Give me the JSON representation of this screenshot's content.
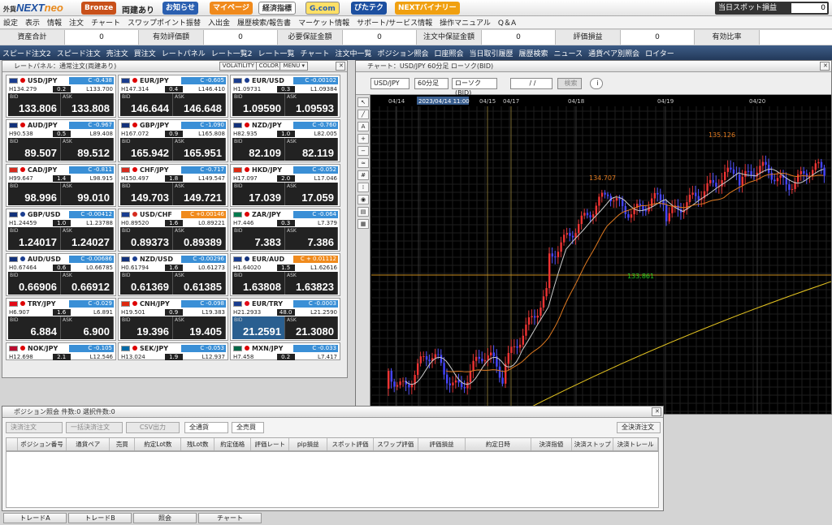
{
  "header": {
    "logo_prefix": "外貨",
    "logo_main": "NEXT",
    "logo_suffix": "neo",
    "rank_badge": "Bronze",
    "two_way": "両建あり",
    "buttons": [
      "お知らせ",
      "マイページ",
      "経済指標",
      "G.com",
      "ぴたテク",
      "NEXTバイナリー"
    ],
    "daily_pnl_label": "当日スポット損益",
    "daily_pnl_value": "0"
  },
  "menu": [
    "設定",
    "表示",
    "情報",
    "注文",
    "チャート",
    "スワップポイント振替",
    "入出金",
    "履歴検索/報告書",
    "マーケット情報",
    "サポート/サービス情報",
    "操作マニュアル",
    "Q＆A"
  ],
  "summary": [
    {
      "label": "資産合計",
      "value": "0"
    },
    {
      "label": "有効評価額",
      "value": "0"
    },
    {
      "label": "必要保証金額",
      "value": "0"
    },
    {
      "label": "注文中保証金額",
      "value": "0"
    },
    {
      "label": "評価損益",
      "value": "0"
    },
    {
      "label": "有効比率",
      "value": ""
    }
  ],
  "toolbar": [
    "スピード注文2",
    "スピード注文",
    "売注文",
    "買注文",
    "レートパネル",
    "レート一覧2",
    "レート一覧",
    "チャート",
    "注文中一覧",
    "ポジション照会",
    "口座照会",
    "当日取引履歴",
    "履歴検索",
    "ニュース",
    "通貨ペア別照会",
    "ロイター"
  ],
  "rate_panel": {
    "title": "レートパネル：通常注文(両建あり)",
    "btn_volatility": "VOLATILITY",
    "btn_color": "COLOR",
    "btn_menu": "MENU ▾",
    "tiles": [
      {
        "pair": "USD/JPY",
        "chg": "C  -0.438",
        "up": false,
        "h": "134.279",
        "sp": "0.2",
        "l": "133.700",
        "bid": "133.806",
        "ask": "133.808",
        "fa": "#1a3d8f",
        "fb": "#d00"
      },
      {
        "pair": "EUR/JPY",
        "chg": "C  -0.605",
        "up": false,
        "h": "147.314",
        "sp": "0.4",
        "l": "146.410",
        "bid": "146.644",
        "ask": "146.648",
        "fa": "#1a3d8f",
        "fb": "#d00"
      },
      {
        "pair": "EUR/USD",
        "chg": "C  -0.00102",
        "up": false,
        "h": "1.09731",
        "sp": "0.3",
        "l": "1.09384",
        "bid": "1.09590",
        "ask": "1.09593",
        "fa": "#1a3d8f",
        "fb": "#1a3d8f"
      },
      {
        "pair": "AUD/JPY",
        "chg": "C  -0.967",
        "up": false,
        "h": "90.538",
        "sp": "0.5",
        "l": "89.408",
        "bid": "89.507",
        "ask": "89.512",
        "fa": "#12317a",
        "fb": "#d00"
      },
      {
        "pair": "GBP/JPY",
        "chg": "C  -1.090",
        "up": false,
        "h": "167.072",
        "sp": "0.9",
        "l": "165.808",
        "bid": "165.942",
        "ask": "165.951",
        "fa": "#12317a",
        "fb": "#d00"
      },
      {
        "pair": "NZD/JPY",
        "chg": "C  -0.760",
        "up": false,
        "h": "82.935",
        "sp": "1.0",
        "l": "82.005",
        "bid": "82.109",
        "ask": "82.119",
        "fa": "#12317a",
        "fb": "#d00"
      },
      {
        "pair": "CAD/JPY",
        "chg": "C  -0.811",
        "up": false,
        "h": "99.647",
        "sp": "1.4",
        "l": "98.915",
        "bid": "98.996",
        "ask": "99.010",
        "fa": "#d52b1e",
        "fb": "#d00"
      },
      {
        "pair": "CHF/JPY",
        "chg": "C  -0.717",
        "up": false,
        "h": "150.497",
        "sp": "1.8",
        "l": "149.547",
        "bid": "149.703",
        "ask": "149.721",
        "fa": "#d52b1e",
        "fb": "#d00"
      },
      {
        "pair": "HKD/JPY",
        "chg": "C  -0.052",
        "up": false,
        "h": "17.097",
        "sp": "2.0",
        "l": "17.046",
        "bid": "17.039",
        "ask": "17.059",
        "fa": "#de2910",
        "fb": "#d00"
      },
      {
        "pair": "GBP/USD",
        "chg": "C  -0.00412",
        "up": false,
        "h": "1.24459",
        "sp": "1.0",
        "l": "1.23788",
        "bid": "1.24017",
        "ask": "1.24027",
        "fa": "#12317a",
        "fb": "#1a3d8f"
      },
      {
        "pair": "USD/CHF",
        "chg": "C  +0.00146",
        "up": true,
        "h": "0.89520",
        "sp": "1.6",
        "l": "0.89221",
        "bid": "0.89373",
        "ask": "0.89389",
        "fa": "#1a3d8f",
        "fb": "#d52b1e"
      },
      {
        "pair": "ZAR/JPY",
        "chg": "C  -0.064",
        "up": false,
        "h": "7.446",
        "sp": "0.3",
        "l": "7.379",
        "bid": "7.383",
        "ask": "7.386",
        "fa": "#007a4d",
        "fb": "#d00"
      },
      {
        "pair": "AUD/USD",
        "chg": "C  -0.00686",
        "up": false,
        "h": "0.67464",
        "sp": "0.6",
        "l": "0.66785",
        "bid": "0.66906",
        "ask": "0.66912",
        "fa": "#12317a",
        "fb": "#1a3d8f"
      },
      {
        "pair": "NZD/USD",
        "chg": "C  -0.00296",
        "up": false,
        "h": "0.61794",
        "sp": "1.6",
        "l": "0.61273",
        "bid": "0.61369",
        "ask": "0.61385",
        "fa": "#12317a",
        "fb": "#1a3d8f"
      },
      {
        "pair": "EUR/AUD",
        "chg": "C  + 0.01112",
        "up": true,
        "h": "1.64020",
        "sp": "1.5",
        "l": "1.62616",
        "bid": "1.63808",
        "ask": "1.63823",
        "fa": "#1a3d8f",
        "fb": "#12317a"
      },
      {
        "pair": "TRY/JPY",
        "chg": "C  -0.029",
        "up": false,
        "h": "6.907",
        "sp": "1.6",
        "l": "6.891",
        "bid": "6.884",
        "ask": "6.900",
        "fa": "#e30a17",
        "fb": "#d00"
      },
      {
        "pair": "CNH/JPY",
        "chg": "C  -0.098",
        "up": false,
        "h": "19.501",
        "sp": "0.9",
        "l": "19.383",
        "bid": "19.396",
        "ask": "19.405",
        "fa": "#de2910",
        "fb": "#d00"
      },
      {
        "pair": "EUR/TRY",
        "chg": "C  -0.0003",
        "up": false,
        "h": "21.2933",
        "sp": "48.0",
        "l": "21.2590",
        "bid": "21.2591",
        "ask": "21.3080",
        "fa": "#1a3d8f",
        "fb": "#e30a17"
      },
      {
        "pair": "NOK/JPY",
        "chg": "C  -0.105",
        "up": false,
        "h": "12.698",
        "sp": "2.1",
        "l": "12.546",
        "bid": "",
        "ask": "",
        "fa": "#ba0c2f",
        "fb": "#d00"
      },
      {
        "pair": "SEK/JPY",
        "chg": "C  -0.053",
        "up": false,
        "h": "13.024",
        "sp": "1.9",
        "l": "12.937",
        "bid": "",
        "ask": "",
        "fa": "#006aa7",
        "fb": "#d00"
      },
      {
        "pair": "MXN/JPY",
        "chg": "C  -0.033",
        "up": false,
        "h": "7.458",
        "sp": "0.2",
        "l": "7.417",
        "bid": "",
        "ask": "",
        "fa": "#006847",
        "fb": "#d00"
      }
    ]
  },
  "chart": {
    "title": "チャート：USD/JPY 60分足 ローソク(BID)",
    "pair_select": "USD/JPY",
    "tf_select": "60分足",
    "type_select": "ローソク(BID)",
    "date_field": "/ /",
    "search_btn": "検索",
    "dates": [
      "04/14",
      "2023/04/14 11:00",
      "04/15",
      "04/17",
      "04/18",
      "04/19",
      "04/20"
    ],
    "price_labels": [
      "135.126",
      "134.707",
      "133.861"
    ]
  },
  "positions": {
    "title": "ポジション照会 件数:0 選択件数:0",
    "btn_settle": "決済注文",
    "btn_bulk": "一括決済注文",
    "btn_csv": "CSV出力",
    "sel_currency": "全通貨",
    "sel_side": "全売買",
    "btn_all_settle": "全決済注文",
    "columns": [
      "ポジション番号",
      "通貨ペア",
      "売買",
      "約定Lot数",
      "残Lot数",
      "約定価格",
      "評価レート",
      "pip損益",
      "スポット評価",
      "スワップ評価",
      "評価損益",
      "約定日時",
      "決済指値",
      "決済ストップ",
      "決済トレール"
    ]
  },
  "tabs": [
    "トレードA",
    "トレードB",
    "照会",
    "チャート"
  ]
}
